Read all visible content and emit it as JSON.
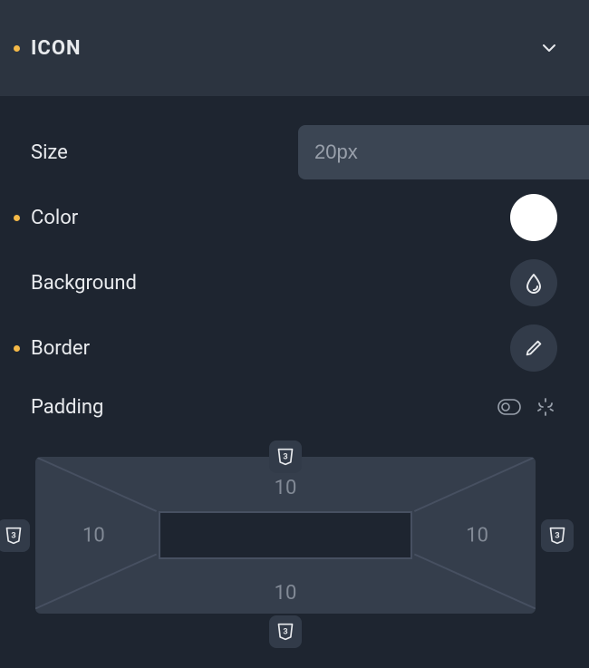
{
  "section": {
    "title": "ICON"
  },
  "size": {
    "label": "Size",
    "placeholder": "20px",
    "value": ""
  },
  "color": {
    "label": "Color",
    "value": "#ffffff"
  },
  "background": {
    "label": "Background"
  },
  "border": {
    "label": "Border"
  },
  "padding": {
    "label": "Padding",
    "top": "10",
    "right": "10",
    "bottom": "10",
    "left": "10"
  }
}
